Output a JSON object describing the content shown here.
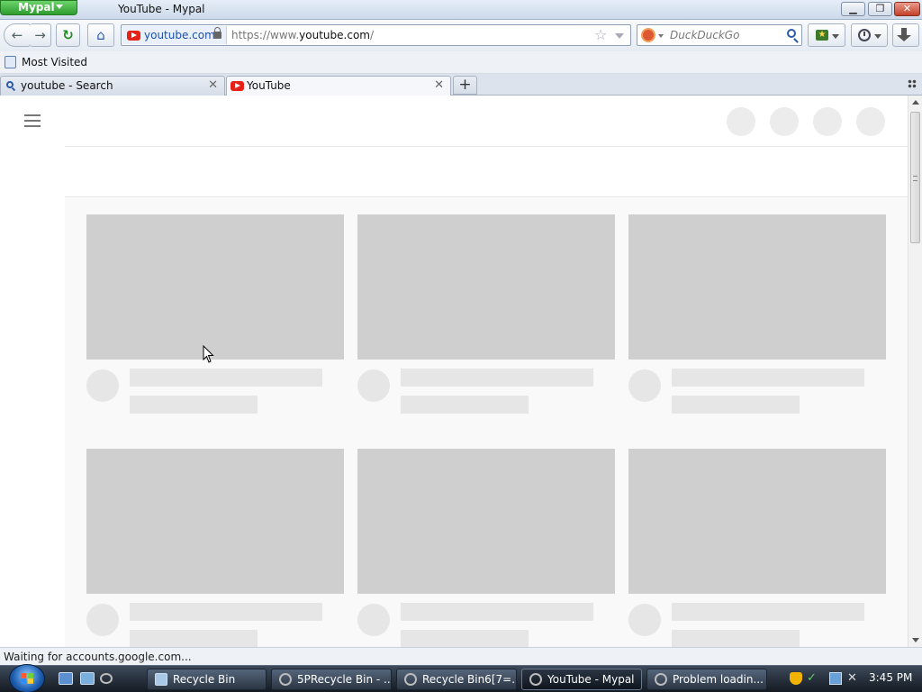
{
  "window": {
    "app_button_label": "Mypal",
    "title": "YouTube - Mypal",
    "controls": {
      "minimize": "▁",
      "maximize": "❐",
      "close": "✕"
    }
  },
  "nav": {
    "back_glyph": "←",
    "forward_glyph": "→",
    "reload_glyph": "↻",
    "home_glyph": "⌂",
    "identity_label": "youtube.com",
    "url_prefix": "https://www.",
    "url_domain": "youtube.com",
    "url_suffix": "/",
    "star_glyph": "☆",
    "search_placeholder": "DuckDuckGo",
    "bookmarks_glyph": "★"
  },
  "bookmarks_bar": {
    "items": [
      {
        "label": "Most Visited"
      }
    ]
  },
  "tabs": [
    {
      "label": "youtube - Search",
      "icon": "search-icon",
      "active": false
    },
    {
      "label": "YouTube",
      "icon": "youtube-icon",
      "active": true
    }
  ],
  "tab_close_glyph": "✕",
  "new_tab_glyph": "+",
  "content": {
    "skeleton_cards": 6,
    "state": "loading"
  },
  "status": {
    "text": "Waiting for accounts.google.com..."
  },
  "taskbar": {
    "items": [
      {
        "label": "Recycle Bin",
        "icon": "recycle-bin-icon",
        "active": false
      },
      {
        "label": "5PRecycle Bin - ...",
        "icon": "mypal-icon",
        "active": false
      },
      {
        "label": "Recycle Bin6[7=...",
        "icon": "mypal-icon",
        "active": false
      },
      {
        "label": "YouTube - Mypal",
        "icon": "mypal-icon",
        "active": true
      },
      {
        "label": "Problem loadin...",
        "icon": "mypal-icon",
        "active": false
      }
    ],
    "tray": {
      "check_glyph": "✓",
      "volume_glyph": "✕"
    },
    "clock": "3:45 PM"
  },
  "colors": {
    "skeleton_thumb": "#cfcfcf",
    "skeleton_text": "#e6e6e6",
    "youtube_red": "#e62117",
    "app_button_green": "#2f9d2f"
  }
}
